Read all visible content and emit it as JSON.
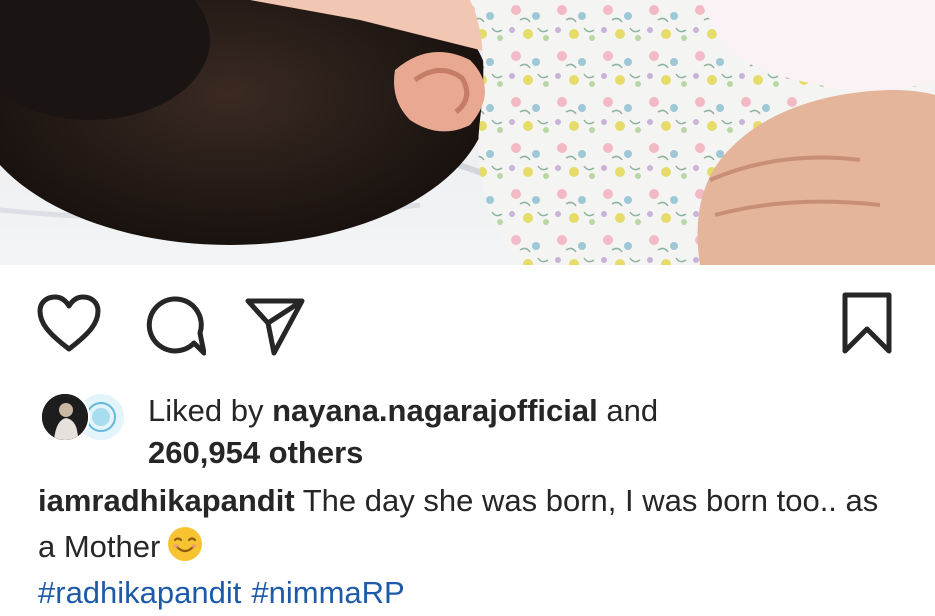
{
  "post": {
    "photo_icon": "baby-photo",
    "colors": {
      "hashtag": "#1e5aa8",
      "text": "#262626",
      "icon": "#262626"
    }
  },
  "actions": {
    "like_icon": "heart-icon",
    "comment_icon": "comment-icon",
    "share_icon": "paper-plane-icon",
    "save_icon": "bookmark-icon"
  },
  "likes": {
    "prefix": "Liked by",
    "user": "nayana.nagarajofficial",
    "conjunction": "and",
    "count_text": "260,954 others"
  },
  "caption": {
    "username": "iamradhikapandit",
    "text": "The day she was born, I was born too.. as a Mother",
    "emoji": "smiling-face-emoji",
    "hashtags": [
      "#radhikapandit",
      "#nimmaRP"
    ]
  }
}
